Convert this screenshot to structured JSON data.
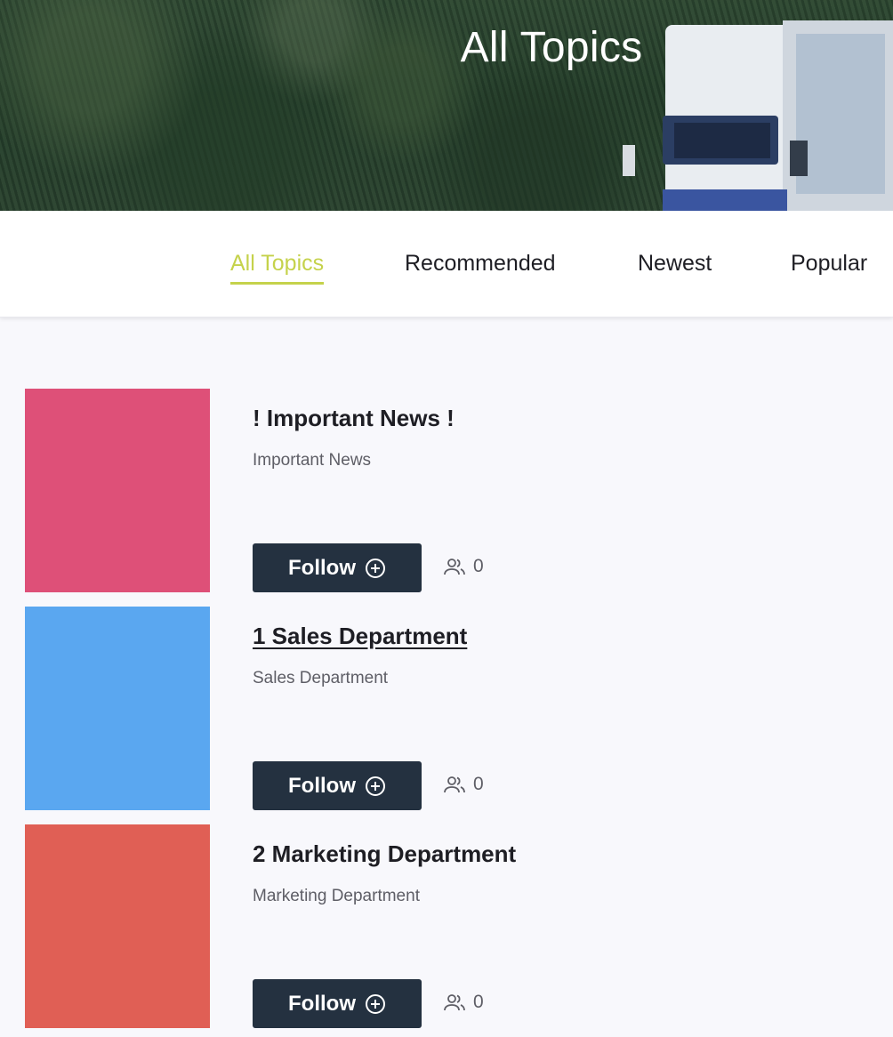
{
  "hero": {
    "title": "All Topics"
  },
  "tabs": [
    {
      "label": "All Topics",
      "active": true
    },
    {
      "label": "Recommended",
      "active": false
    },
    {
      "label": "Newest",
      "active": false
    },
    {
      "label": "Popular",
      "active": false
    }
  ],
  "topics": [
    {
      "title": "! Important News !",
      "description": "Important News",
      "follow_label": "Follow",
      "follower_count": "0",
      "color": "#de5078"
    },
    {
      "title": "1 Sales Department",
      "description": "Sales Department",
      "follow_label": "Follow",
      "follower_count": "0",
      "color": "#5aa7f0"
    },
    {
      "title": "2 Marketing Department",
      "description": "Marketing Department",
      "follow_label": "Follow",
      "follower_count": "0",
      "color": "#e05f55"
    }
  ],
  "colors": {
    "accent": "#c5d24b",
    "button": "#243140"
  },
  "icons": {
    "follow": "plus-circle-icon",
    "followers": "users-icon"
  }
}
